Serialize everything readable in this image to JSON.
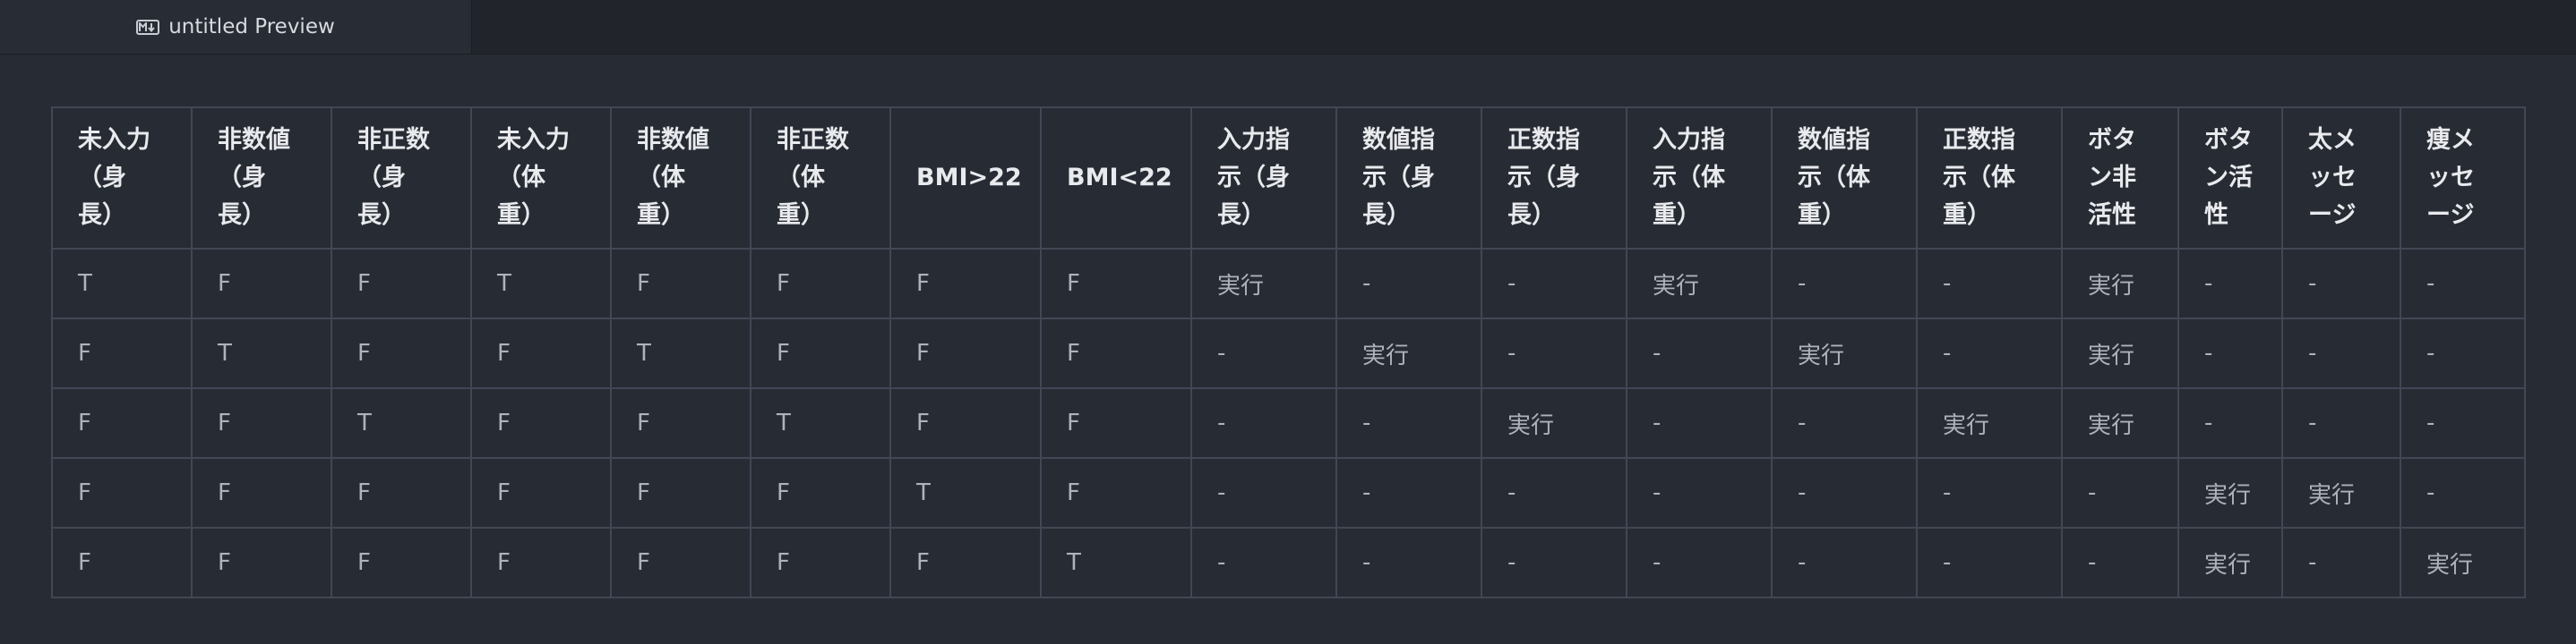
{
  "tab": {
    "icon": "markdown-icon",
    "title": "untitled Preview"
  },
  "table": {
    "headers": [
      "未入力\n（身\n長）",
      "非数値\n（身\n長）",
      "非正数\n（身\n長）",
      "未入力\n（体\n重）",
      "非数値\n（体\n重）",
      "非正数\n（体\n重）",
      "BMI>22",
      "BMI<22",
      "入力指\n示（身\n長）",
      "数値指\n示（身\n長）",
      "正数指\n示（身\n長）",
      "入力指\n示（体\n重）",
      "数値指\n示（体\n重）",
      "正数指\n示（体\n重）",
      "ボタン非\n活性",
      "ボタ\nン活\n性",
      "太メ\nッセ\nージ",
      "痩メ\nッセ\nージ"
    ],
    "rows": [
      [
        "T",
        "F",
        "F",
        "T",
        "F",
        "F",
        "F",
        "F",
        "実行",
        "-",
        "-",
        "実行",
        "-",
        "-",
        "実行",
        "-",
        "-",
        "-"
      ],
      [
        "F",
        "T",
        "F",
        "F",
        "T",
        "F",
        "F",
        "F",
        "-",
        "実行",
        "-",
        "-",
        "実行",
        "-",
        "実行",
        "-",
        "-",
        "-"
      ],
      [
        "F",
        "F",
        "T",
        "F",
        "F",
        "T",
        "F",
        "F",
        "-",
        "-",
        "実行",
        "-",
        "-",
        "実行",
        "実行",
        "-",
        "-",
        "-"
      ],
      [
        "F",
        "F",
        "F",
        "F",
        "F",
        "F",
        "T",
        "F",
        "-",
        "-",
        "-",
        "-",
        "-",
        "-",
        "-",
        "実行",
        "実行",
        "-"
      ],
      [
        "F",
        "F",
        "F",
        "F",
        "F",
        "F",
        "F",
        "T",
        "-",
        "-",
        "-",
        "-",
        "-",
        "-",
        "-",
        "実行",
        "-",
        "実行"
      ]
    ]
  }
}
